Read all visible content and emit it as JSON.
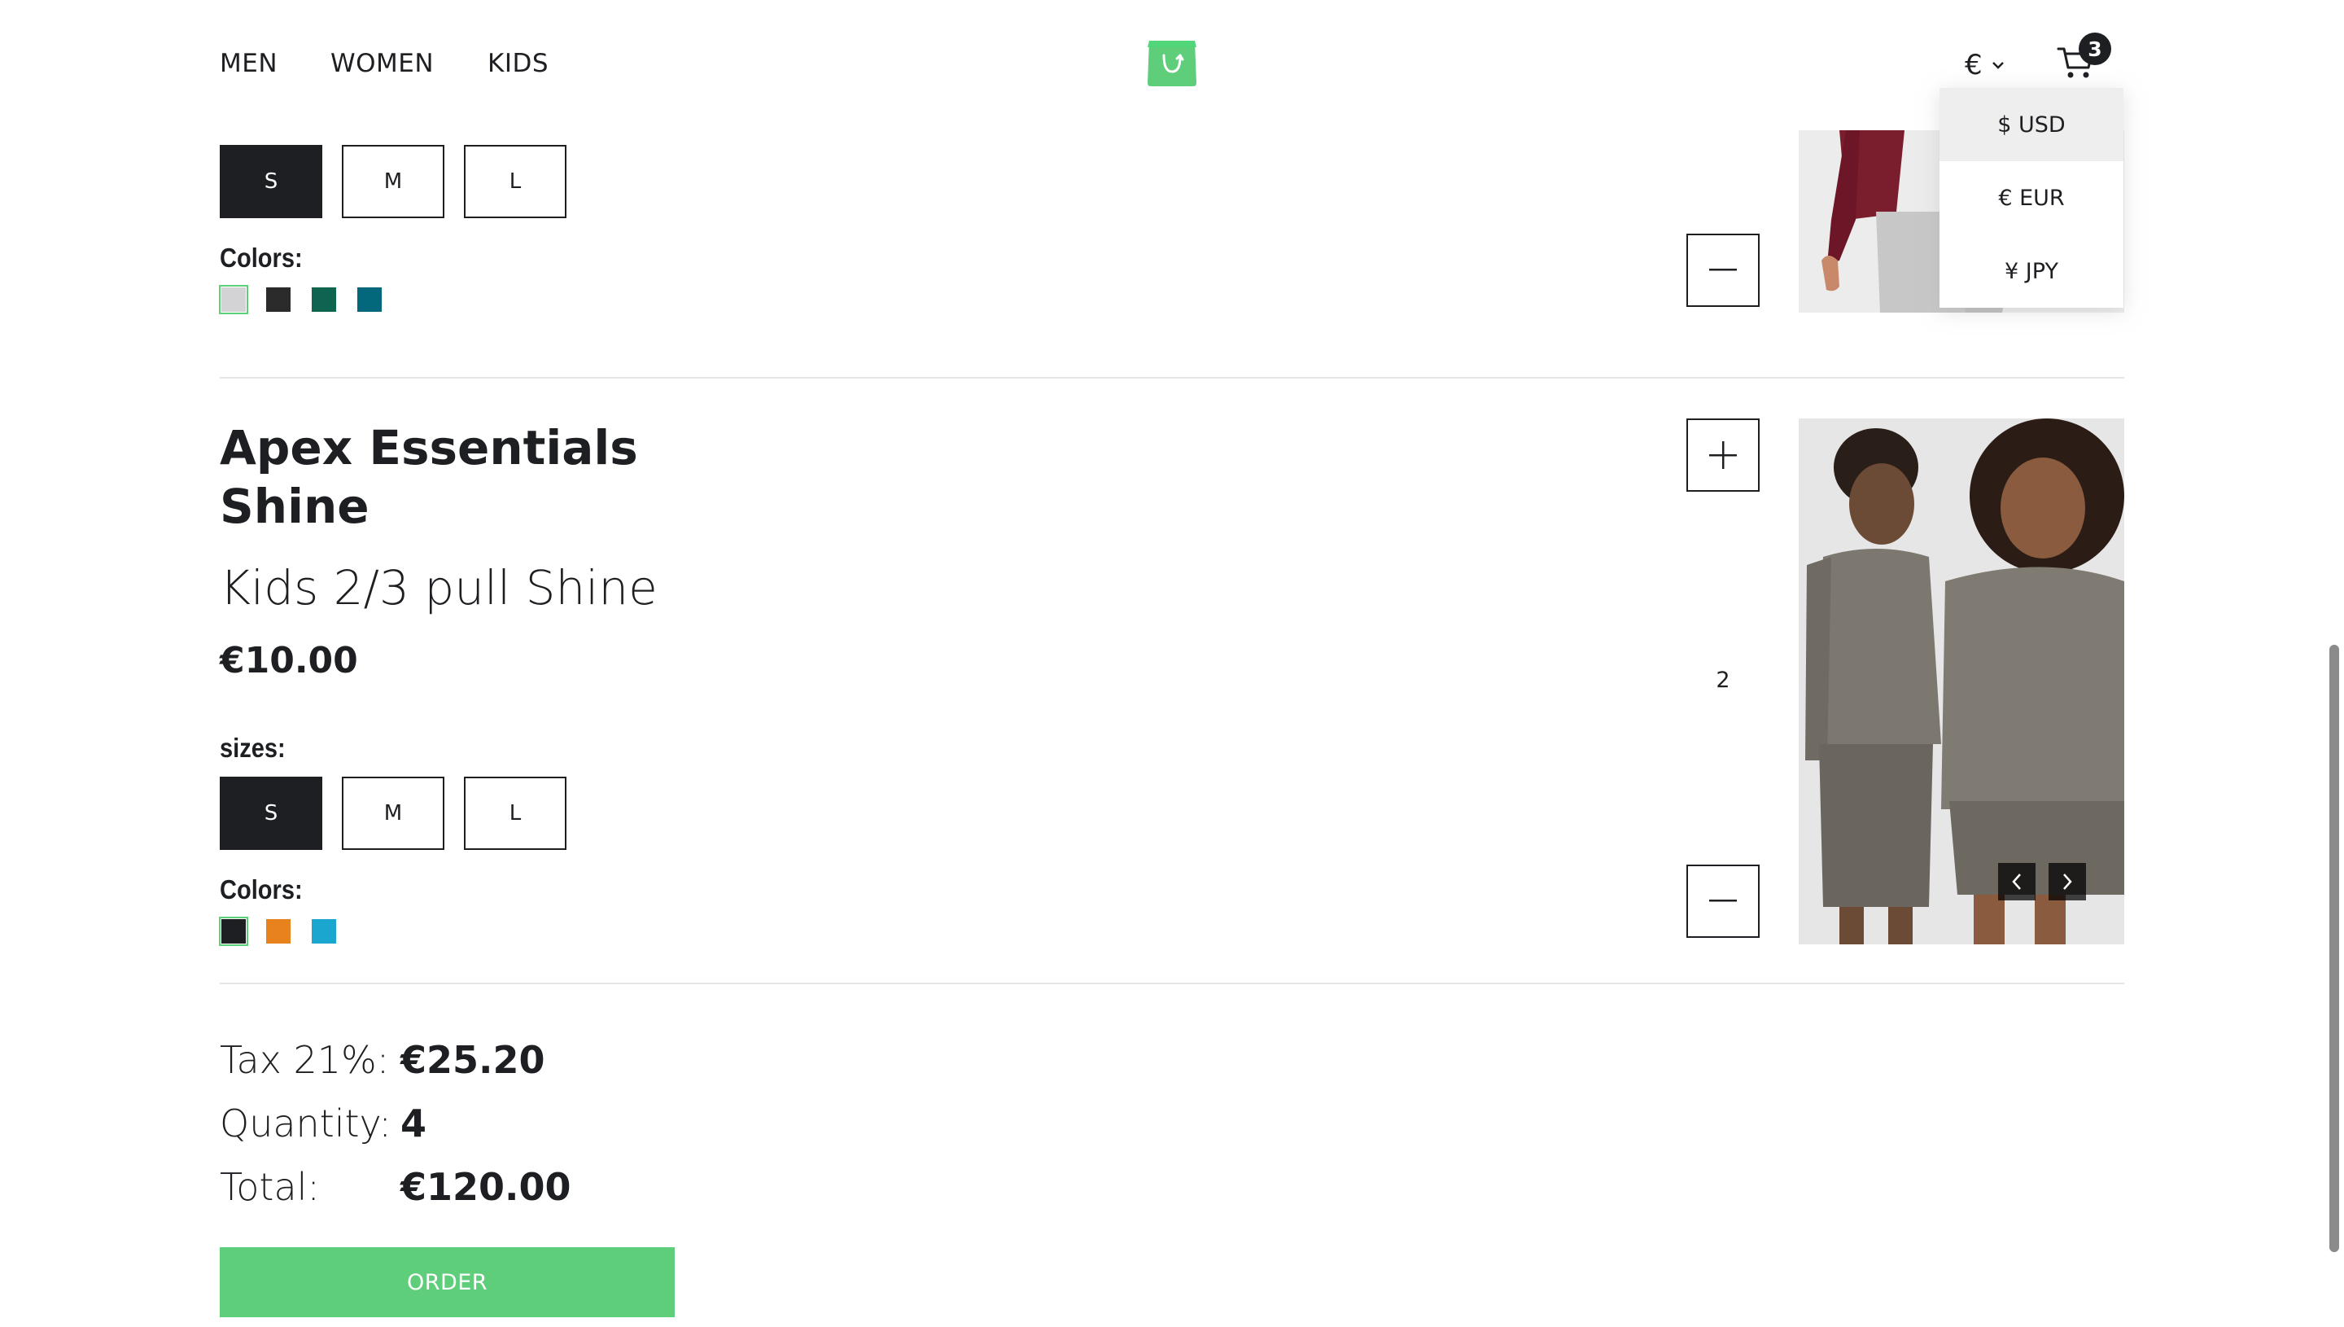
{
  "nav": {
    "categories": [
      {
        "label": "MEN"
      },
      {
        "label": "WOMEN"
      },
      {
        "label": "KIDS"
      }
    ]
  },
  "header": {
    "currency_symbol": "€",
    "cart_count": "3"
  },
  "currency_dropdown": {
    "options": [
      {
        "label": "$ USD",
        "active": true
      },
      {
        "label": "€ EUR",
        "active": false
      },
      {
        "label": "¥ JPY",
        "active": false
      }
    ]
  },
  "cart_items": [
    {
      "sizes": [
        "S",
        "M",
        "L"
      ],
      "selected_size": "S",
      "colors_label": "Colors:",
      "colors": [
        "#d3d2d5",
        "#2b2b2b",
        "#0f6450",
        "#03687c"
      ],
      "selected_color": "#d3d2d5"
    },
    {
      "brand": "Apex Essentials Shine",
      "name": "Kids 2/3 pull Shine",
      "price": "€10.00",
      "sizes_label": "sizes:",
      "sizes": [
        "S",
        "M",
        "L"
      ],
      "selected_size": "S",
      "colors_label": "Colors:",
      "colors": [
        "#1d1f22",
        "#e8821c",
        "#1ba6d0"
      ],
      "selected_color": "#1d1f22",
      "quantity": "2"
    }
  ],
  "summary": {
    "tax_label": "Tax 21%:",
    "tax_value": "€25.20",
    "quantity_label": "Quantity:",
    "quantity_value": "4",
    "total_label": "Total:",
    "total_value": "€120.00"
  },
  "order_button": "ORDER",
  "colors": {
    "accent": "#5ece7b",
    "text": "#1d1f22"
  }
}
